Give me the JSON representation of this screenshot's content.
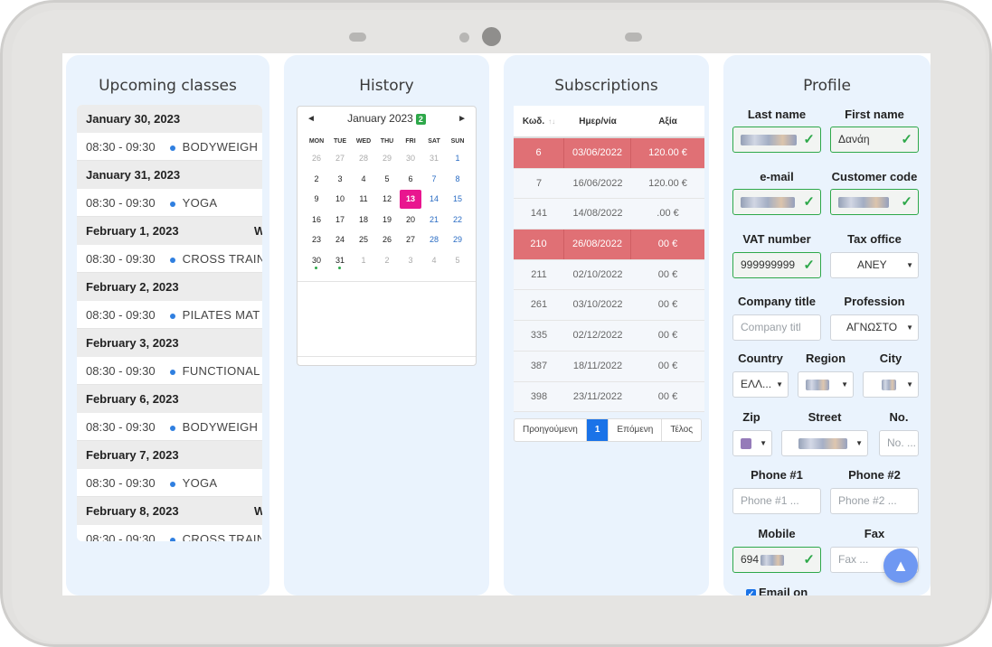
{
  "panels": {
    "upcoming_title": "Upcoming classes",
    "history_title": "History",
    "subscriptions_title": "Subscriptions",
    "profile_title": "Profile"
  },
  "upcoming": [
    {
      "date": "January 30, 2023",
      "extra": "",
      "time": "08:30 - 09:30",
      "class": "BODYWEIGH"
    },
    {
      "date": "January 31, 2023",
      "extra": "",
      "time": "08:30 - 09:30",
      "class": "YOGA"
    },
    {
      "date": "February 1, 2023",
      "extra": "W",
      "time": "08:30 - 09:30",
      "class": "CROSS TRAIN"
    },
    {
      "date": "February 2, 2023",
      "extra": "",
      "time": "08:30 - 09:30",
      "class": "PILATES MAT"
    },
    {
      "date": "February 3, 2023",
      "extra": "",
      "time": "08:30 - 09:30",
      "class": "FUNCTIONAL"
    },
    {
      "date": "February 6, 2023",
      "extra": "",
      "time": "08:30 - 09:30",
      "class": "BODYWEIGH"
    },
    {
      "date": "February 7, 2023",
      "extra": "",
      "time": "08:30 - 09:30",
      "class": "YOGA"
    },
    {
      "date": "February 8, 2023",
      "extra": "W",
      "time": "08:30 - 09:30",
      "class": "CROSS TRAIN"
    }
  ],
  "calendar": {
    "prev": "◄",
    "next": "►",
    "month_label": "January 2023",
    "badge": "2",
    "dow": [
      "MON",
      "TUE",
      "WED",
      "THU",
      "FRI",
      "SAT",
      "SUN"
    ],
    "weeks": [
      [
        "26",
        "27",
        "28",
        "29",
        "30",
        "31",
        "1"
      ],
      [
        "2",
        "3",
        "4",
        "5",
        "6",
        "7",
        "8"
      ],
      [
        "9",
        "10",
        "11",
        "12",
        "13",
        "14",
        "15"
      ],
      [
        "16",
        "17",
        "18",
        "19",
        "20",
        "21",
        "22"
      ],
      [
        "23",
        "24",
        "25",
        "26",
        "27",
        "28",
        "29"
      ],
      [
        "30",
        "31",
        "1",
        "2",
        "3",
        "4",
        "5"
      ]
    ]
  },
  "subscriptions": {
    "headers": [
      "Κωδ.",
      "Ημερ/νία",
      "Αξία"
    ],
    "sort_glyph": "↑↓",
    "rows": [
      {
        "id": "6",
        "date": "03/06/2022",
        "value": "120.00 €",
        "highlight": true
      },
      {
        "id": "7",
        "date": "16/06/2022",
        "value": "120.00 €",
        "highlight": false
      },
      {
        "id": "141",
        "date": "14/08/2022",
        "value": ".00 €",
        "highlight": false
      },
      {
        "id": "210",
        "date": "26/08/2022",
        "value": "00 €",
        "highlight": true
      },
      {
        "id": "211",
        "date": "02/10/2022",
        "value": "00 €",
        "highlight": false
      },
      {
        "id": "261",
        "date": "03/10/2022",
        "value": "00 €",
        "highlight": false
      },
      {
        "id": "335",
        "date": "02/12/2022",
        "value": "00 €",
        "highlight": false
      },
      {
        "id": "387",
        "date": "18/11/2022",
        "value": "00 €",
        "highlight": false
      },
      {
        "id": "398",
        "date": "23/11/2022",
        "value": "00 €",
        "highlight": false
      }
    ],
    "pager": {
      "prev": "Προηγούμενη",
      "current": "1",
      "next": "Επόμενη",
      "last": "Τέλος"
    }
  },
  "profile": {
    "last_name_label": "Last name",
    "first_name_label": "First name",
    "first_name_value": "Δανάη",
    "email_label": "e-mail",
    "customer_code_label": "Customer code",
    "vat_label": "VAT number",
    "vat_value": "999999999",
    "tax_office_label": "Tax office",
    "tax_office_value": "ΑΝΕΥ",
    "company_title_label": "Company title",
    "company_title_placeholder": "Company titl",
    "profession_label": "Profession",
    "profession_value": "ΑΓΝΩΣΤΟ",
    "country_label": "Country",
    "country_value": "ΕΛΛ...",
    "region_label": "Region",
    "city_label": "City",
    "zip_label": "Zip",
    "street_label": "Street",
    "no_label": "No.",
    "no_placeholder": "No. ...",
    "phone1_label": "Phone #1",
    "phone1_placeholder": "Phone #1 ...",
    "phone2_label": "Phone #2",
    "phone2_placeholder": "Phone #2 ...",
    "mobile_label": "Mobile",
    "mobile_value": "694",
    "fax_label": "Fax",
    "fax_placeholder": "Fax ...",
    "email_on_label": "Email on",
    "check_glyph": "✓",
    "caret_glyph": "▼"
  },
  "fab_glyph": "▲"
}
